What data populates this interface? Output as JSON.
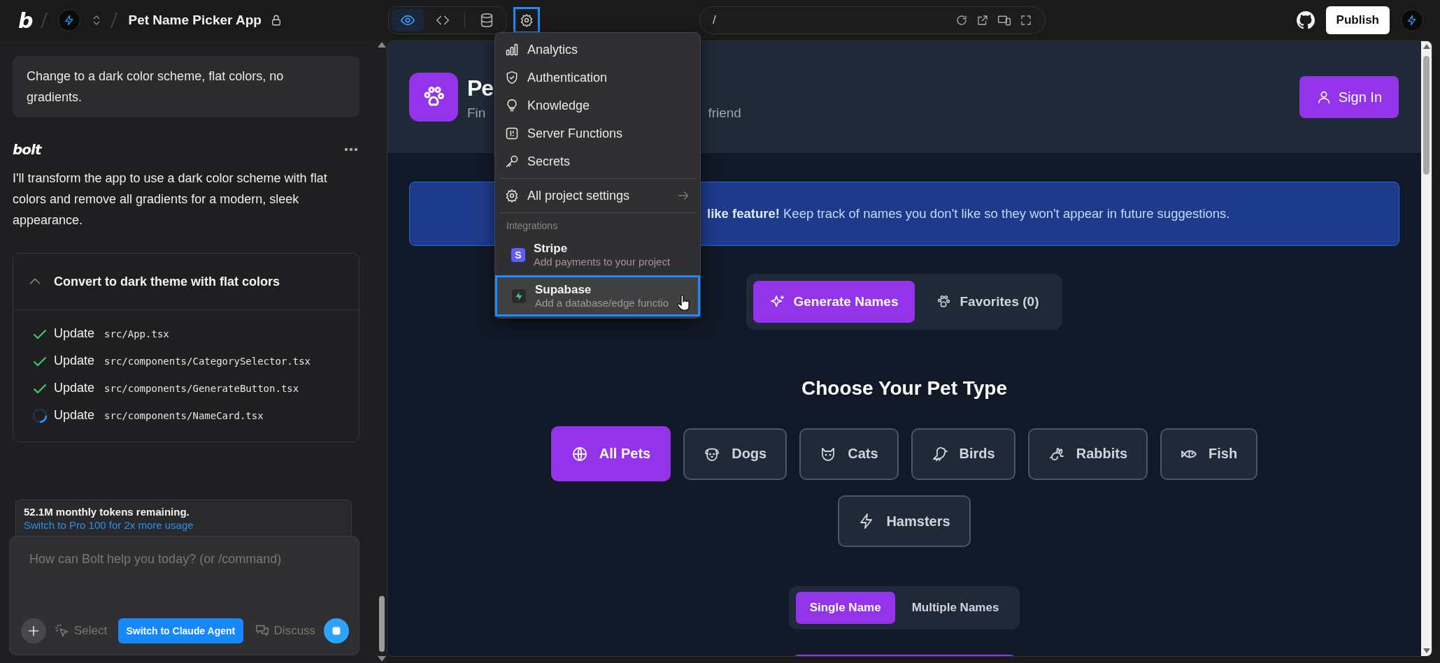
{
  "topbar": {
    "logo": "b",
    "project_title": "Pet Name Picker App",
    "view_tabs": [
      {
        "kind": "preview",
        "selected": true
      },
      {
        "kind": "code",
        "selected": false
      },
      {
        "kind": "database",
        "selected": false
      }
    ],
    "settings_open": true,
    "url": "/",
    "publish_button": "Publish"
  },
  "chat": {
    "user_message": "Change to a dark color scheme, flat colors, no gradients.",
    "assistant_name": "bolt",
    "assistant_message": "I'll transform the app to use a dark color scheme with flat colors and remove all gradients for a modern, sleek appearance.",
    "task": {
      "title": "Convert to dark theme with flat colors",
      "expanded": true,
      "steps": [
        {
          "action": "Update",
          "file": "src/App.tsx",
          "done": true
        },
        {
          "action": "Update",
          "file": "src/components/CategorySelector.tsx",
          "done": true
        },
        {
          "action": "Update",
          "file": "src/components/GenerateButton.tsx",
          "done": true
        },
        {
          "action": "Update",
          "file": "src/components/NameCard.tsx",
          "done": false
        }
      ]
    },
    "usage": {
      "text": "52.1M monthly tokens remaining.",
      "link": "Switch to Pro 100 for 2x more usage"
    },
    "composer": {
      "placeholder": "How can Bolt help you today? (or /command)",
      "select_label": "Select",
      "agent_button": "Switch to Claude Agent",
      "discuss_label": "Discuss"
    }
  },
  "settings_menu": {
    "items": [
      {
        "kind": "analytics",
        "label": "Analytics"
      },
      {
        "kind": "authentication",
        "label": "Authentication"
      },
      {
        "kind": "knowledge",
        "label": "Knowledge"
      },
      {
        "kind": "functions",
        "label": "Server Functions"
      },
      {
        "kind": "secrets",
        "label": "Secrets"
      }
    ],
    "all_settings": "All project settings",
    "section_label": "Integrations",
    "integrations": [
      {
        "kind": "stripe",
        "badge": "S",
        "name": "Stripe",
        "description": "Add payments to your project",
        "selected": false
      },
      {
        "kind": "supabase",
        "name": "Supabase",
        "description": "Add a database/edge functio",
        "selected": true
      }
    ]
  },
  "preview": {
    "header": {
      "title": "Pe",
      "subtitle_start": "Fin",
      "subtitle_end": "friend",
      "sign_in": "Sign In"
    },
    "banner": "**like feature!** Keep track of names you don't like so they won't appear in future suggestions.",
    "view_tabs": [
      {
        "label": "Generate Names",
        "selected": true
      },
      {
        "label": "Favorites (0)",
        "selected": false
      }
    ],
    "pet_type_heading": "Choose Your Pet Type",
    "pet_types": [
      {
        "label": "All Pets",
        "selected": true
      },
      {
        "label": "Dogs",
        "selected": false
      },
      {
        "label": "Cats",
        "selected": false
      },
      {
        "label": "Birds",
        "selected": false
      },
      {
        "label": "Rabbits",
        "selected": false
      },
      {
        "label": "Fish",
        "selected": false
      },
      {
        "label": "Hamsters",
        "selected": false
      }
    ],
    "name_modes": [
      {
        "label": "Single Name",
        "selected": true
      },
      {
        "label": "Multiple Names",
        "selected": false
      }
    ]
  }
}
